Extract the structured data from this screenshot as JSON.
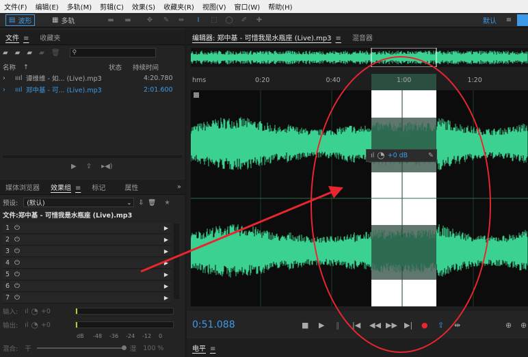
{
  "menu": [
    "文件(F)",
    "编辑(E)",
    "多轨(M)",
    "剪辑(C)",
    "效果(S)",
    "收藏夹(R)",
    "视图(V)",
    "窗口(W)",
    "帮助(H)"
  ],
  "toolbar": {
    "waveform": "波形",
    "multitrack": "多轨",
    "workspace": "默认"
  },
  "files_panel": {
    "tab_files": "文件",
    "tab_favorites": "收藏夹",
    "col_name": "名称",
    "col_status": "状态",
    "col_duration": "持续时间",
    "files": [
      {
        "name": "谭维维 - 如... (Live).mp3",
        "duration": "4:20.780"
      },
      {
        "name": "郑中基 - 可... (Live).mp3",
        "duration": "2:01.600"
      }
    ]
  },
  "effects_panel": {
    "tab_media": "媒体浏览器",
    "tab_rack": "效果组",
    "tab_markers": "标记",
    "tab_props": "属性",
    "preset_label": "预设:",
    "preset_value": "(默认)",
    "file_label": "文件:郑中基 - 可惜我是水瓶座 (Live).mp3",
    "slots": [
      "1",
      "2",
      "3",
      "4",
      "5",
      "6",
      "7"
    ],
    "input_label": "输入:",
    "output_label": "输出:",
    "zero": "+0",
    "db_scale": [
      "dB",
      "-48",
      "-36",
      "-24",
      "-12",
      "0"
    ],
    "mix_label": "混合:",
    "dry": "干",
    "wet": "湿",
    "mix_pct": "100 %"
  },
  "editor": {
    "tab_editor": "编辑器: 郑中基 - 可惜我是水瓶座 (Live).mp3",
    "tab_mixer": "混音器",
    "ruler": {
      "unit": "hms",
      "ticks": [
        "0:20",
        "0:40",
        "1:00",
        "1:20"
      ]
    },
    "hud": "+0 dB",
    "time": "0:51.088",
    "levels_tab": "电平",
    "selection": {
      "start_sec": 51.088,
      "end_sec": 69.5
    }
  },
  "colors": {
    "wave": "#3bd191",
    "wave_selected": "#2a4a3c",
    "selection_bg": "#ffffff",
    "accent": "#3d9ae8",
    "annotation": "#e8262f"
  }
}
